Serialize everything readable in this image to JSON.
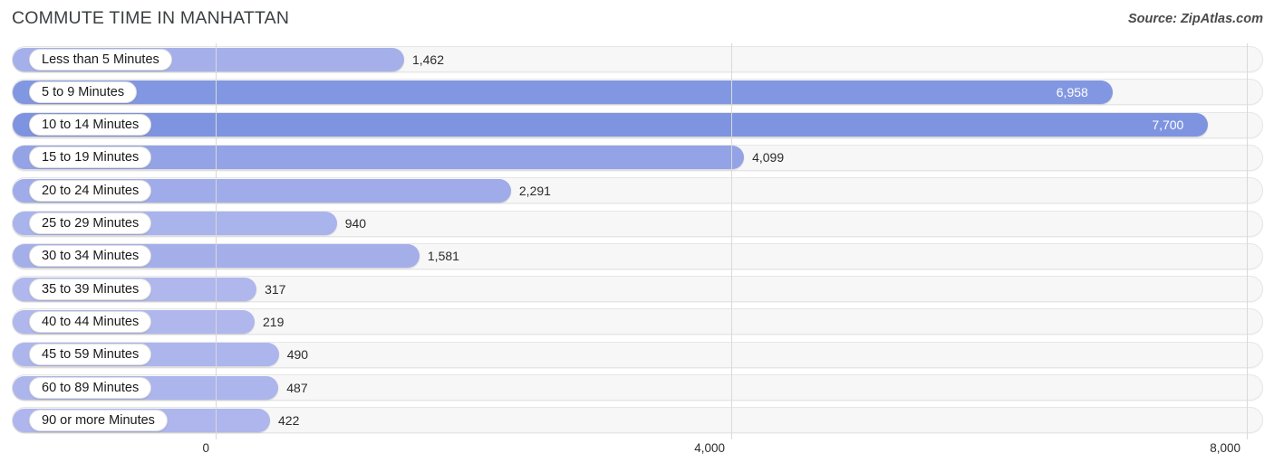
{
  "header": {
    "title": "COMMUTE TIME IN MANHATTAN",
    "source": "Source: ZipAtlas.com"
  },
  "chart_data": {
    "type": "bar",
    "orientation": "horizontal",
    "title": "COMMUTE TIME IN MANHATTAN",
    "xlabel": "",
    "ylabel": "",
    "xlim": [
      0,
      8000
    ],
    "grid": true,
    "legend": false,
    "axis_ticks": [
      "0",
      "4,000",
      "8,000"
    ],
    "axis_tick_values": [
      0,
      4000,
      8000
    ],
    "categories": [
      "Less than 5 Minutes",
      "5 to 9 Minutes",
      "10 to 14 Minutes",
      "15 to 19 Minutes",
      "20 to 24 Minutes",
      "25 to 29 Minutes",
      "30 to 34 Minutes",
      "35 to 39 Minutes",
      "40 to 44 Minutes",
      "45 to 59 Minutes",
      "60 to 89 Minutes",
      "90 or more Minutes"
    ],
    "values": [
      1462,
      6958,
      7700,
      4099,
      2291,
      940,
      1581,
      317,
      219,
      490,
      487,
      422
    ],
    "value_labels": [
      "1,462",
      "6,958",
      "7,700",
      "4,099",
      "2,291",
      "940",
      "1,581",
      "317",
      "219",
      "490",
      "487",
      "422"
    ],
    "colors": {
      "bar_low": "#b2b9ee",
      "bar_high": "#7e94e0",
      "track": "#f7f7f7",
      "gridline": "#d9d9d9",
      "label_pill": "#ffffff",
      "value_text": "#2b2b2b",
      "value_text_inside": "#ffffff"
    }
  }
}
